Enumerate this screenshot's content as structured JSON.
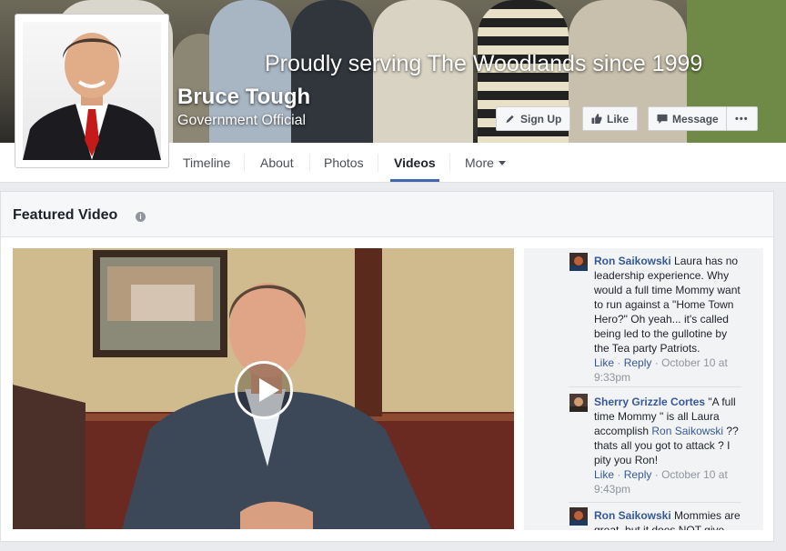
{
  "cover": {
    "tagline": "Proudly serving The Woodlands since 1999",
    "name": "Bruce Tough",
    "category": "Government Official",
    "buttons": {
      "sign_up": "Sign Up",
      "like": "Like",
      "message": "Message",
      "more": "•••"
    }
  },
  "nav": {
    "tabs": [
      "Timeline",
      "About",
      "Photos",
      "Videos",
      "More"
    ],
    "active": "Videos"
  },
  "featured": {
    "title": "Featured Video"
  },
  "comments": [
    {
      "author": "Ron Saikowski",
      "text": "Laura has no leadership experience. Why would a full time Mommy want to run against a \"Home Town Hero?\" Oh yeah... it's called being led to the gullotine by the Tea party Patriots.",
      "like": "Like",
      "reply": "Reply",
      "time": "October 10 at 9:33pm"
    },
    {
      "author": "Sherry Grizzle Cortes",
      "text_before": "\"A full time Mommy \" is all Laura accomplish",
      "mention": "Ron Saikowski",
      "text_after": "?? thats all you got to attack ? I pity you Ron!",
      "like": "Like",
      "reply": "Reply",
      "time": "October 10 at 9:43pm"
    },
    {
      "author": "Ron Saikowski",
      "text": "Mommies are great, but it does NOT give"
    }
  ],
  "colors": {
    "link": "#365899",
    "active_tab": "#4267b2"
  },
  "icons": [
    "pencil-icon",
    "thumbs-up-icon",
    "message-icon",
    "info-icon",
    "play-icon",
    "caret-down-icon"
  ]
}
